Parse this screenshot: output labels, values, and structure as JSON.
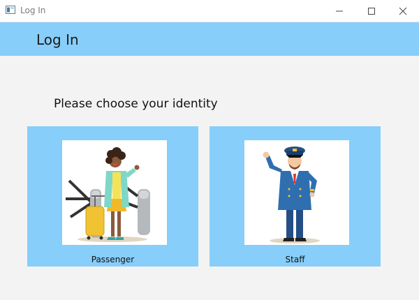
{
  "window": {
    "title": "Log In"
  },
  "header": {
    "title": "Log In"
  },
  "prompt": "Please choose your identity",
  "cards": [
    {
      "label": "Passenger",
      "icon": "passenger-illustration"
    },
    {
      "label": "Staff",
      "icon": "pilot-illustration"
    }
  ],
  "colors": {
    "accent": "#87cefa",
    "background": "#f3f3f3"
  }
}
